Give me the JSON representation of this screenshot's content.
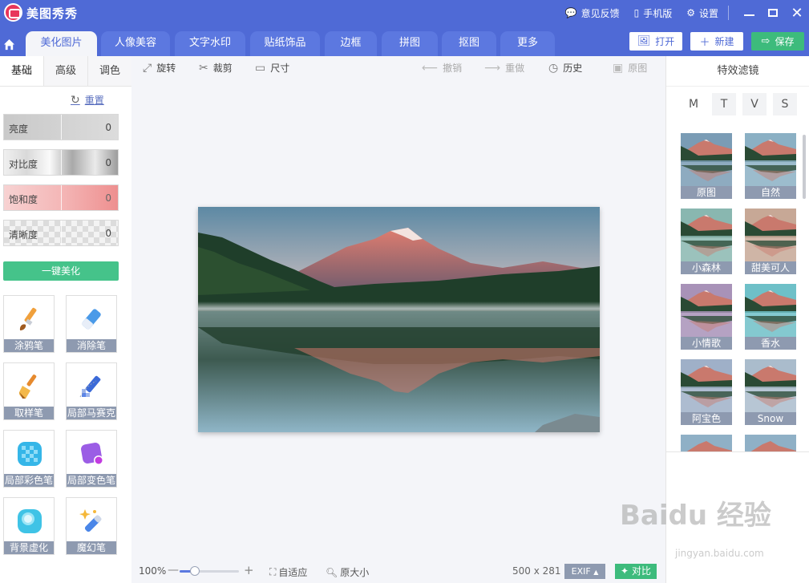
{
  "app": {
    "title": "美图秀秀",
    "feedback": "意见反馈",
    "mobile": "手机版",
    "settings": "设置"
  },
  "tabs": [
    {
      "label": "美化图片",
      "active": true
    },
    {
      "label": "人像美容"
    },
    {
      "label": "文字水印"
    },
    {
      "label": "贴纸饰品"
    },
    {
      "label": "边框"
    },
    {
      "label": "拼图"
    },
    {
      "label": "抠图"
    },
    {
      "label": "更多"
    }
  ],
  "actions": {
    "open": "打开",
    "new": "新建",
    "save": "保存"
  },
  "left": {
    "subtabs": [
      "基础",
      "高级",
      "调色"
    ],
    "reset": "重置",
    "sliders": [
      {
        "label": "亮度",
        "value": "0"
      },
      {
        "label": "对比度",
        "value": "0"
      },
      {
        "label": "饱和度",
        "value": "0"
      },
      {
        "label": "清晰度",
        "value": "0"
      }
    ],
    "oneclick": "一键美化",
    "tools": [
      {
        "label": "涂鸦笔",
        "icon": "paintbrush-icon"
      },
      {
        "label": "消除笔",
        "icon": "eraser-icon"
      },
      {
        "label": "取样笔",
        "icon": "sample-brush-icon"
      },
      {
        "label": "局部马赛克",
        "icon": "mosaic-pen-icon"
      },
      {
        "label": "局部彩色笔",
        "icon": "local-color-pen-icon"
      },
      {
        "label": "局部变色笔",
        "icon": "color-change-pen-icon"
      },
      {
        "label": "背景虚化",
        "icon": "background-blur-icon"
      },
      {
        "label": "魔幻笔",
        "icon": "magic-pen-icon"
      }
    ]
  },
  "toolbar": {
    "rotate": "旋转",
    "crop": "裁剪",
    "size": "尺寸",
    "undo": "撤销",
    "redo": "重做",
    "history": "历史",
    "original": "原图"
  },
  "status": {
    "zoom": "100%",
    "zoom_level": 0.25,
    "fit": "自适应",
    "actual": "原大小",
    "dims": "500 x 281",
    "exif": "EXIF",
    "compare": "对比"
  },
  "right": {
    "title": "特效滤镜",
    "letters": [
      "M",
      "T",
      "V",
      "S"
    ],
    "filters": [
      "原图",
      "自然",
      "小森林",
      "甜美可人",
      "小情歌",
      "香水",
      "阿宝色",
      "Snow"
    ]
  },
  "watermark": {
    "logo": "Baidu 经验",
    "sub": "jingyan.baidu.com"
  },
  "colors": {
    "brand": "#4f6ad6",
    "green": "#3dbb7c",
    "label_gray": "#8e9ab0"
  }
}
